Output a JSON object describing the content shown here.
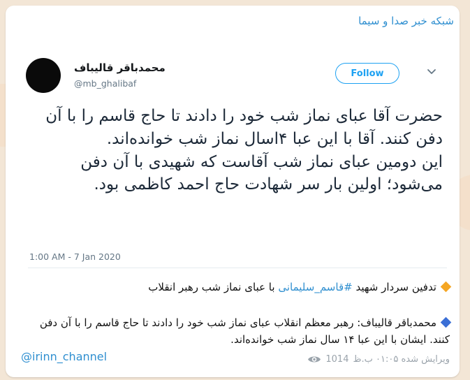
{
  "channel_name": "شبکه خبر صدا و سیما",
  "tweet": {
    "author_name": "محمدباقر قالیباف",
    "handle": "@mb_ghalibaf",
    "follow_label": "Follow",
    "text_line1": "حضرت آقا عبای نماز شب خود را دادند تا حاج قاسم را با آن دفن کنند. آقا با این عبا ۴اسال نماز شب خوانده‌اند.",
    "text_line2": "این دومین عبای نماز شب آقاست که شهیدی با آن دفن می‌شود؛ اولین بار سر شهادت حاج احمد کاظمی بود.",
    "timestamp": "1:00 AM - 7 Jan 2020"
  },
  "message": {
    "line1_before": "تدفین سردار شهید",
    "line1_hashtag": "#قاسم_سلیمانی",
    "line1_after": "با عبای نماز شب رهبر انقلاب",
    "line2": "محمدباقر قالیباف: رهبر معظم انقلاب عبای نماز شب خود را دادند تا حاج قاسم را با آن دفن کنند. ایشان با این عبا ۱۴ سال نماز شب خوانده‌اند.",
    "orange_marker_color": "#f5a623",
    "blue_marker_color": "#3b6fd6"
  },
  "footer": {
    "source_link": "@irinn_channel",
    "views": "1014",
    "edited_time": "ویرایش شده ۰۱:۰۵ ب.ظ"
  },
  "icons": {
    "views": "eye-icon",
    "tweet_menu": "chevron-down-icon"
  }
}
